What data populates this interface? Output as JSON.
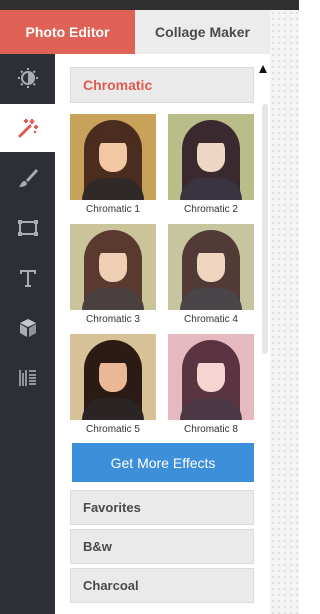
{
  "tabs": [
    {
      "label": "Photo Editor",
      "active": true
    },
    {
      "label": "Collage Maker",
      "active": false
    }
  ],
  "sidebar": {
    "items": [
      {
        "icon": "exposure-icon",
        "active": false
      },
      {
        "icon": "magic-wand-icon",
        "active": true
      },
      {
        "icon": "brush-icon",
        "active": false
      },
      {
        "icon": "frame-icon",
        "active": false
      },
      {
        "icon": "text-icon",
        "active": false
      },
      {
        "icon": "cube-icon",
        "active": false
      },
      {
        "icon": "texture-icon",
        "active": false
      }
    ]
  },
  "panel": {
    "category_title": "Chromatic",
    "thumbnails": [
      {
        "label": "Chromatic 1"
      },
      {
        "label": "Chromatic 2"
      },
      {
        "label": "Chromatic 3"
      },
      {
        "label": "Chromatic 4"
      },
      {
        "label": "Chromatic 5"
      },
      {
        "label": "Chromatic 8"
      }
    ],
    "cta_label": "Get More Effects",
    "categories": [
      "Favorites",
      "B&w",
      "Charcoal"
    ]
  },
  "colors": {
    "accent": "#e06156",
    "button_blue": "#3d8fd9",
    "sidebar_bg": "#2c2f33"
  }
}
